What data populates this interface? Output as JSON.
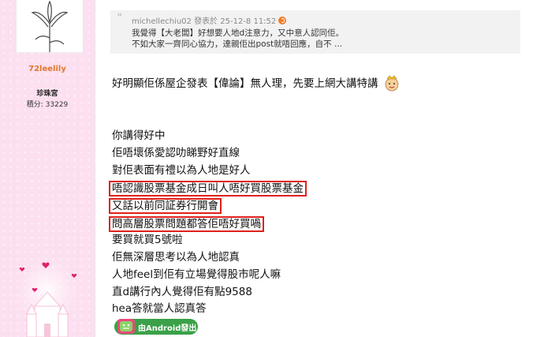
{
  "user": {
    "username": "72leelily",
    "rank": "珍珠宮",
    "points": "積分: 33229"
  },
  "quote": {
    "meta": "michellechiu02 發表於 25-12-8 11:52",
    "line1": "我覺得【大老闆】好想要人地d注意力，又中意人認同佢。",
    "line2": "不如大家一齊同心協力，達親佢出post就唔回應，自不 ..."
  },
  "post": {
    "line1": "好明顯佢係屋企發表【偉論】無人理，先要上網大講特講",
    "lines": [
      "你講得好中",
      "佢唔壞係愛認叻睇野好直線",
      "對佢表面有禮以為人地是好人",
      "唔認識股票基金成日叫人唔好買股票基金",
      "又話以前同証券行開會",
      "問高層股票問題都答佢唔好買喎",
      "要買就買5號啦",
      "佢無深層思考以為人地認真",
      "人地feel到佢有立場覺得股市呢人嘛",
      "直d講行內人覺得佢有點9588",
      "hea答就當人認真答"
    ]
  },
  "footer": {
    "android_label": "由Android發出"
  },
  "colors": {
    "username": "#e0782a",
    "highlight_box": "#e0201b",
    "sidebar_bg": "#fcdff0",
    "android_badge": "#3aa148"
  }
}
